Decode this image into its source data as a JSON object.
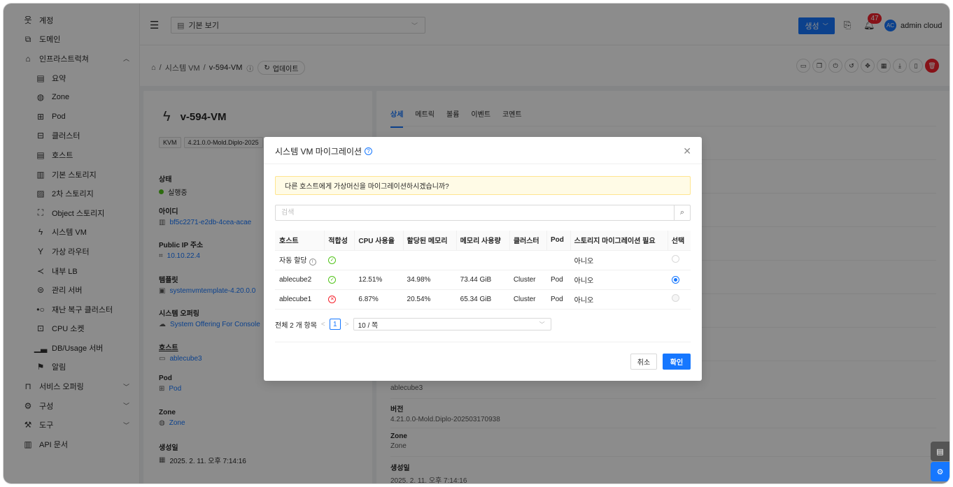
{
  "sidebar": {
    "items": [
      {
        "label": "계정",
        "icon": "user-icon"
      },
      {
        "label": "도메인",
        "icon": "domain-icon"
      },
      {
        "label": "인프라스트럭쳐",
        "icon": "bank-icon",
        "expanded": true
      },
      {
        "label": "요약",
        "icon": "summary-icon",
        "sub": true
      },
      {
        "label": "Zone",
        "icon": "globe-icon",
        "sub": true
      },
      {
        "label": "Pod",
        "icon": "pod-icon",
        "sub": true
      },
      {
        "label": "클러스터",
        "icon": "cluster-icon",
        "sub": true
      },
      {
        "label": "호스트",
        "icon": "host-icon",
        "sub": true
      },
      {
        "label": "기본 스토리지",
        "icon": "storage-icon",
        "sub": true
      },
      {
        "label": "2차 스토리지",
        "icon": "picture-icon",
        "sub": true
      },
      {
        "label": "Object 스토리지",
        "icon": "object-storage-icon",
        "sub": true
      },
      {
        "label": "시스템 VM",
        "icon": "thunderbolt-icon",
        "sub": true
      },
      {
        "label": "가상 라우터",
        "icon": "router-icon",
        "sub": true
      },
      {
        "label": "내부 LB",
        "icon": "share-icon",
        "sub": true
      },
      {
        "label": "관리 서버",
        "icon": "management-server-icon",
        "sub": true
      },
      {
        "label": "재난 복구 클러스터",
        "icon": "dr-cluster-icon",
        "sub": true
      },
      {
        "label": "CPU 소켓",
        "icon": "cpu-icon",
        "sub": true
      },
      {
        "label": "DB/Usage 서버",
        "icon": "bar-chart-icon",
        "sub": true
      },
      {
        "label": "알림",
        "icon": "flag-icon",
        "sub": true
      },
      {
        "label": "서비스 오퍼링",
        "icon": "shopping-icon",
        "collapsible": true
      },
      {
        "label": "구성",
        "icon": "setting-icon",
        "collapsible": true
      },
      {
        "label": "도구",
        "icon": "tool-icon",
        "collapsible": true
      },
      {
        "label": "API 문서",
        "icon": "read-icon"
      }
    ]
  },
  "header": {
    "view_select": "기본 보기",
    "create_label": "생성",
    "notification_count": "47",
    "avatar_initials": "AC",
    "user_name": "admin cloud"
  },
  "breadcrumb": {
    "root_label": "시스템 VM",
    "current": "v-594-VM",
    "refresh_label": "업데이트"
  },
  "vm": {
    "name": "v-594-VM",
    "tags": [
      "KVM",
      "4.21.0.0-Mold.Diplo-2025"
    ],
    "fields": {
      "state_label": "상태",
      "state_value": "실행중",
      "id_label": "아이디",
      "id_value": "bf5c2271-e2db-4cea-acae",
      "public_ip_label": "Public IP 주소",
      "public_ip_value": "10.10.22.4",
      "template_label": "템플릿",
      "template_value": "systemvmtemplate-4.20.0.0",
      "offering_label": "시스템 오퍼링",
      "offering_value": "System Offering For Console",
      "host_label": "호스트",
      "host_value": "ablecube3",
      "pod_label": "Pod",
      "pod_value": "Pod",
      "zone_label": "Zone",
      "zone_value": "Zone",
      "created_label": "생성일",
      "created_value": "2025. 2. 11. 오후 7:14:16"
    }
  },
  "detail_tabs": [
    "상세",
    "메트릭",
    "볼륨",
    "이벤트",
    "코멘트"
  ],
  "detail_right": {
    "host_value": "ablecube3",
    "version_label": "버전",
    "version_value": "4.21.0.0-Mold.Diplo-202503170938",
    "zone_label": "Zone",
    "zone_value": "Zone",
    "created_label": "생성일",
    "created_value": "2025. 2. 11. 오후 7:14:16"
  },
  "modal": {
    "title": "시스템 VM 마이그레이션",
    "alert": "다른 호스트에게 가상머신을 마이그레이션하시겠습니까?",
    "search_placeholder": "검색",
    "columns": [
      "호스트",
      "적합성",
      "CPU 사용율",
      "할당된 메모리",
      "메모리 사용량",
      "클러스터",
      "Pod",
      "스토리지 마이그레이션 필요",
      "선택"
    ],
    "rows": [
      {
        "host": "자동 할당",
        "suitable": "ok",
        "cpu": "",
        "mem_alloc": "",
        "mem_used": "",
        "cluster": "",
        "pod": "",
        "storage_migration": "아니오",
        "selected": false,
        "disabled": false,
        "auto": true
      },
      {
        "host": "ablecube2",
        "suitable": "ok",
        "cpu": "12.51%",
        "mem_alloc": "34.98%",
        "mem_used": "73.44 GiB",
        "cluster": "Cluster",
        "pod": "Pod",
        "storage_migration": "아니오",
        "selected": true,
        "disabled": false
      },
      {
        "host": "ablecube1",
        "suitable": "bad",
        "cpu": "6.87%",
        "mem_alloc": "20.54%",
        "mem_used": "65.34 GiB",
        "cluster": "Cluster",
        "pod": "Pod",
        "storage_migration": "아니오",
        "selected": false,
        "disabled": true
      }
    ],
    "pagination": {
      "total": "전체 2 개 항목",
      "page": "1",
      "page_size": "10 / 쪽"
    },
    "cancel_label": "취소",
    "ok_label": "확인"
  },
  "colors": {
    "primary": "#1677ff",
    "success": "#52c41a",
    "danger": "#f5222d",
    "warning_bg": "#fffbe6"
  }
}
